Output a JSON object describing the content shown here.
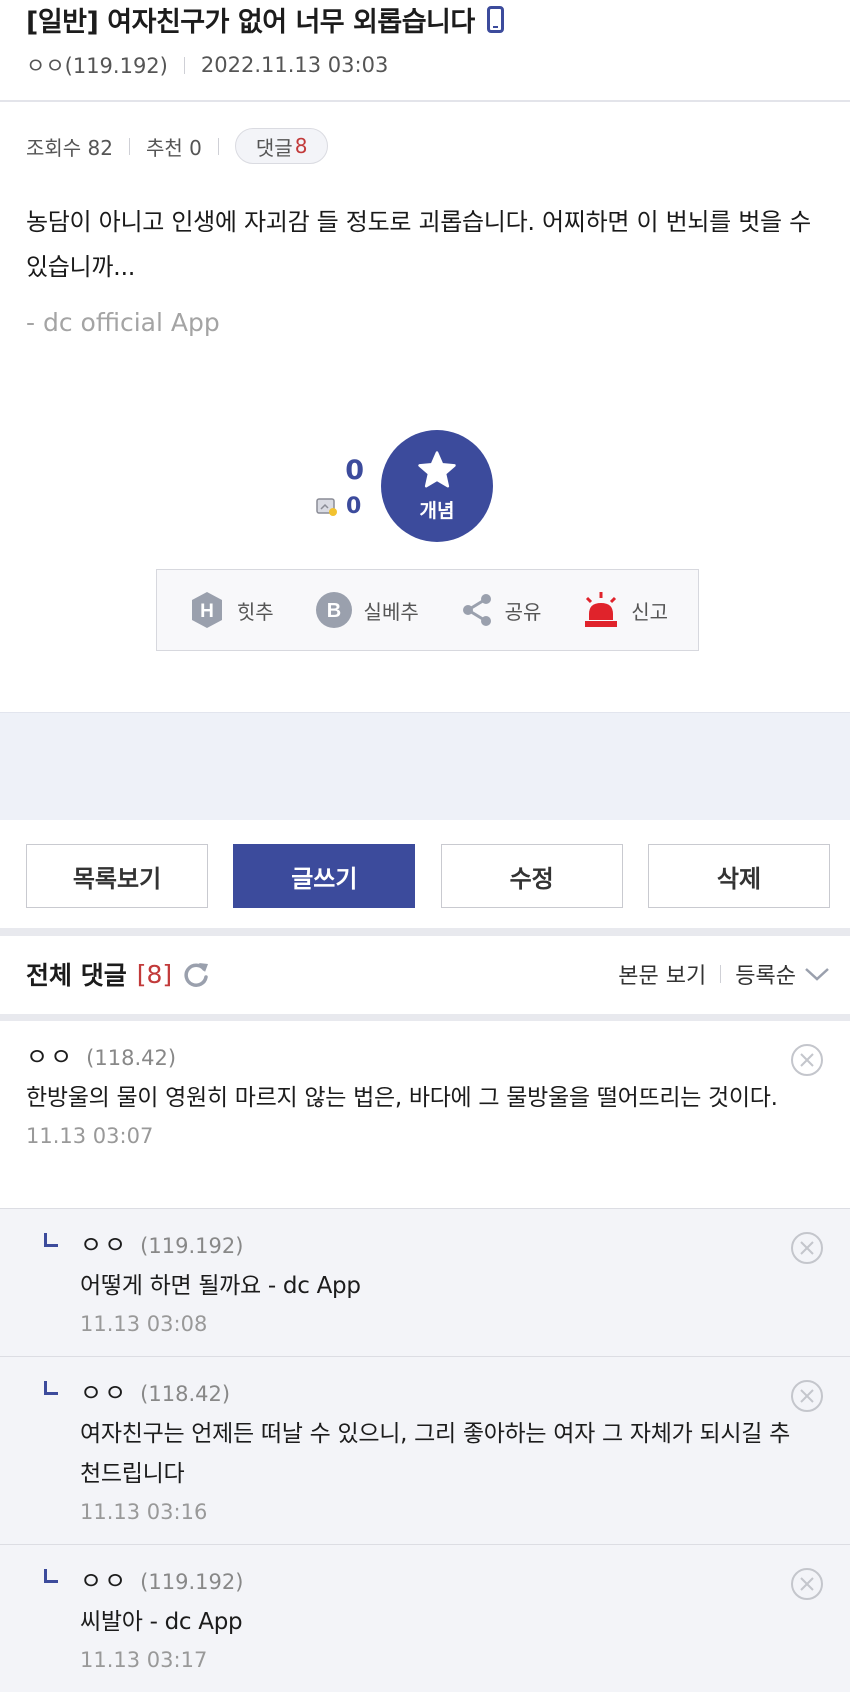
{
  "post": {
    "title": "[일반] 여자친구가 없어 너무 외롭습니다",
    "author": "ㅇㅇ(119.192)",
    "date": "2022.11.13 03:03",
    "views_label": "조회수 82",
    "recommend_label": "추천 0",
    "comments_label": "댓글",
    "comments_count": "8",
    "body": "농담이 아니고 인생에 자괴감 들 정도로 괴롭습니다. 어찌하면 이 번뇌를 벗을 수 있습니까...",
    "source": "- dc official App"
  },
  "recommend": {
    "up_count": "0",
    "fix_count": "0",
    "button_label": "개념"
  },
  "actions": {
    "hit": "힛추",
    "best": "실베추",
    "share": "공유",
    "report": "신고"
  },
  "buttons": {
    "list": "목록보기",
    "write": "글쓰기",
    "edit": "수정",
    "delete": "삭제"
  },
  "comments_header": {
    "title": "전체 댓글",
    "count": "[8]",
    "view_body": "본문 보기",
    "sort": "등록순"
  },
  "comments": [
    {
      "nick": "ㅇㅇ",
      "ip": "(118.42)",
      "text": "한방울의 물이 영원히 마르지 않는 법은, 바다에 그 물방울을 떨어뜨리는 것이다.",
      "date": "11.13 03:07"
    },
    {
      "nick": "ㅇㅇ",
      "ip": "(119.192)",
      "text": "어떻게 하면 될까요 - dc App",
      "date": "11.13 03:08"
    },
    {
      "nick": "ㅇㅇ",
      "ip": "(118.42)",
      "text": "여자친구는 언제든 떠날 수 있으니, 그리 좋아하는 여자 그 자체가 되시길 추천드립니다",
      "date": "11.13 03:16"
    },
    {
      "nick": "ㅇㅇ",
      "ip": "(119.192)",
      "text": "씨발아 - dc App",
      "date": "11.13 03:17"
    }
  ],
  "colors": {
    "accent": "#3c4b9c",
    "count_red": "#c23a3a",
    "report_red": "#e0232b"
  }
}
